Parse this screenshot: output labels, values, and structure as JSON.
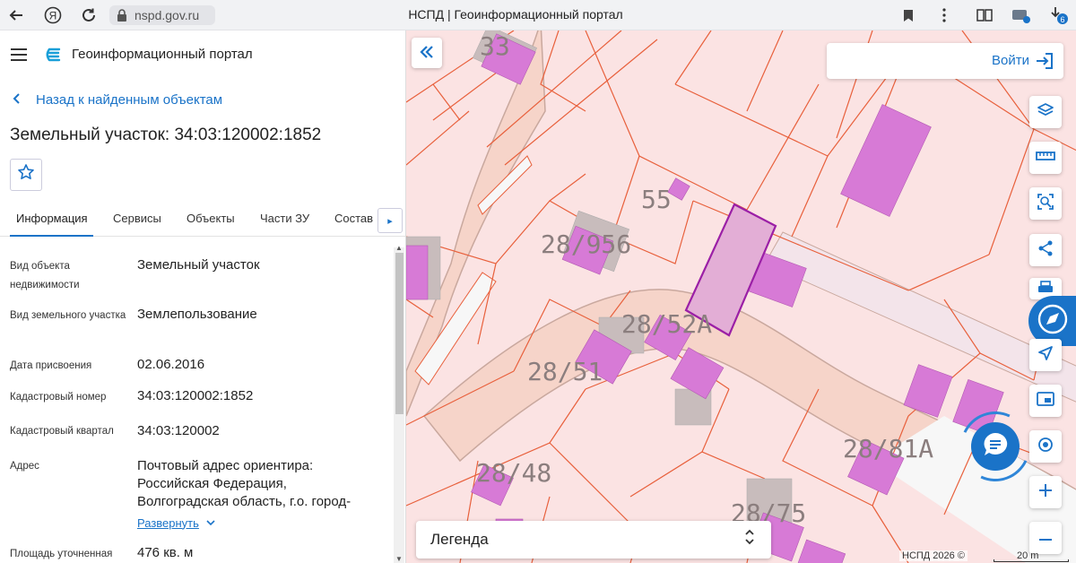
{
  "browser": {
    "url": "nspd.gov.ru",
    "tab_title": "НСПД | Геоинформационный портал",
    "downloads_badge": "6"
  },
  "sidebar": {
    "portal_title": "Геоинформационный портал",
    "back_link": "Назад к найденным объектам",
    "parcel_title": "Земельный участок: 34:03:120002:1852",
    "tabs": [
      {
        "label": "Информация",
        "active": true
      },
      {
        "label": "Сервисы",
        "active": false
      },
      {
        "label": "Объекты",
        "active": false
      },
      {
        "label": "Части ЗУ",
        "active": false
      },
      {
        "label": "Состав",
        "active": false
      }
    ],
    "properties": [
      {
        "label": "Вид объекта недвижимости",
        "value": "Земельный участок"
      },
      {
        "label": "Вид земельного участка",
        "value": "Землепользование"
      },
      {
        "label": "Дата присвоения",
        "value": "02.06.2016"
      },
      {
        "label": "Кадастровый номер",
        "value": "34:03:120002:1852"
      },
      {
        "label": "Кадастровый квартал",
        "value": "34:03:120002"
      },
      {
        "label": "Адрес",
        "value": "Почтовый адрес ориентира: Российская Федерация, Волгоградская область, г.о. город-",
        "expand": "Развернуть"
      },
      {
        "label": "Площадь уточненная",
        "value": "476 кв. м"
      }
    ]
  },
  "map": {
    "login_label": "Войти",
    "legend_label": "Легенда",
    "attribution": "НСПД 2026 ©",
    "scale_label": "20 m",
    "parcel_labels": [
      "33",
      "55",
      "28/956",
      "28/52А",
      "28/51",
      "28/81А",
      "28/48",
      "28/75"
    ],
    "colors": {
      "parcel_line": "#e8603c",
      "building": "#d77ad6",
      "selected": "#9b1fa6",
      "road": "#f6d4c9",
      "accent": "#1a73c8"
    }
  }
}
